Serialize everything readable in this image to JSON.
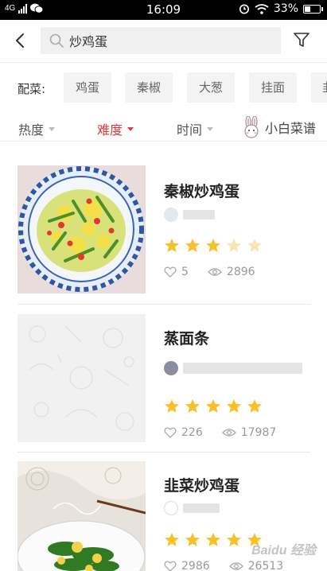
{
  "status_bar": {
    "network": "4G",
    "time": "16:09",
    "battery": "33%"
  },
  "search": {
    "query": "炒鸡蛋"
  },
  "ingredients": {
    "label": "配菜:",
    "chips": [
      "鸡蛋",
      "秦椒",
      "大葱",
      "挂面",
      "韭"
    ]
  },
  "sort": {
    "items": [
      "热度",
      "难度",
      "时间"
    ],
    "active": "难度",
    "mascot_label": "小白菜谱"
  },
  "recipes": [
    {
      "title": "秦椒炒鸡蛋",
      "rating": 3,
      "likes": "5",
      "views": "2896"
    },
    {
      "title": "蒸面条",
      "rating": 5,
      "likes": "226",
      "views": "17987"
    },
    {
      "title": "韭菜炒鸡蛋",
      "rating": 5,
      "likes": "2986",
      "views": "26513"
    }
  ],
  "colors": {
    "accent": "#e03a3a",
    "star_on": "#f6c12b",
    "star_off": "#f7e6b3"
  },
  "watermark": "Baidu 经验"
}
